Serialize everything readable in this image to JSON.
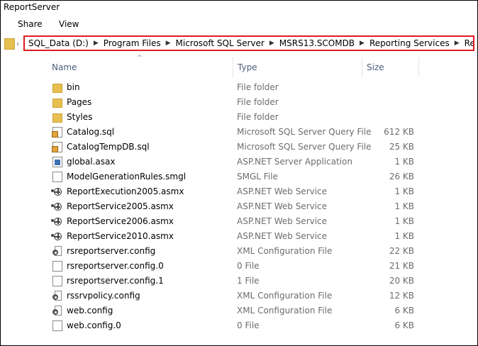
{
  "window": {
    "title": "ReportServer"
  },
  "ribbon": {
    "tabs": [
      "Share",
      "View"
    ]
  },
  "address": {
    "back_glyph": "‹",
    "crumbs": [
      "SQL_Data (D:)",
      "Program Files",
      "Microsoft SQL Server",
      "MSRS13.SCOMDB",
      "Reporting Services",
      "ReportServer"
    ],
    "highlight_color": "#e01b24"
  },
  "columns": {
    "name": "Name",
    "type": "Type",
    "size": "Size",
    "sort_glyph": "^"
  },
  "files": [
    {
      "name": "bin",
      "type": "File folder",
      "size": "",
      "icon": "folder-icon"
    },
    {
      "name": "Pages",
      "type": "File folder",
      "size": "",
      "icon": "folder-icon"
    },
    {
      "name": "Styles",
      "type": "File folder",
      "size": "",
      "icon": "folder-icon"
    },
    {
      "name": "Catalog.sql",
      "type": "Microsoft SQL Server Query File",
      "size": "612 KB",
      "icon": "sql-file-icon"
    },
    {
      "name": "CatalogTempDB.sql",
      "type": "Microsoft SQL Server Query File",
      "size": "25 KB",
      "icon": "sql-file-icon"
    },
    {
      "name": "global.asax",
      "type": "ASP.NET Server Application",
      "size": "1 KB",
      "icon": "asax-file-icon"
    },
    {
      "name": "ModelGenerationRules.smgl",
      "type": "SMGL File",
      "size": "26 KB",
      "icon": "file-icon"
    },
    {
      "name": "ReportExecution2005.asmx",
      "type": "ASP.NET Web Service",
      "size": "1 KB",
      "icon": "web-service-icon"
    },
    {
      "name": "ReportService2005.asmx",
      "type": "ASP.NET Web Service",
      "size": "1 KB",
      "icon": "web-service-icon"
    },
    {
      "name": "ReportService2006.asmx",
      "type": "ASP.NET Web Service",
      "size": "1 KB",
      "icon": "web-service-icon"
    },
    {
      "name": "ReportService2010.asmx",
      "type": "ASP.NET Web Service",
      "size": "1 KB",
      "icon": "web-service-icon"
    },
    {
      "name": "rsreportserver.config",
      "type": "XML Configuration File",
      "size": "22 KB",
      "icon": "config-file-icon"
    },
    {
      "name": "rsreportserver.config.0",
      "type": "0 File",
      "size": "21 KB",
      "icon": "file-icon"
    },
    {
      "name": "rsreportserver.config.1",
      "type": "1 File",
      "size": "20 KB",
      "icon": "file-icon"
    },
    {
      "name": "rssrvpolicy.config",
      "type": "XML Configuration File",
      "size": "12 KB",
      "icon": "config-file-icon"
    },
    {
      "name": "web.config",
      "type": "XML Configuration File",
      "size": "6 KB",
      "icon": "config-file-icon"
    },
    {
      "name": "web.config.0",
      "type": "0 File",
      "size": "6 KB",
      "icon": "file-icon"
    }
  ]
}
